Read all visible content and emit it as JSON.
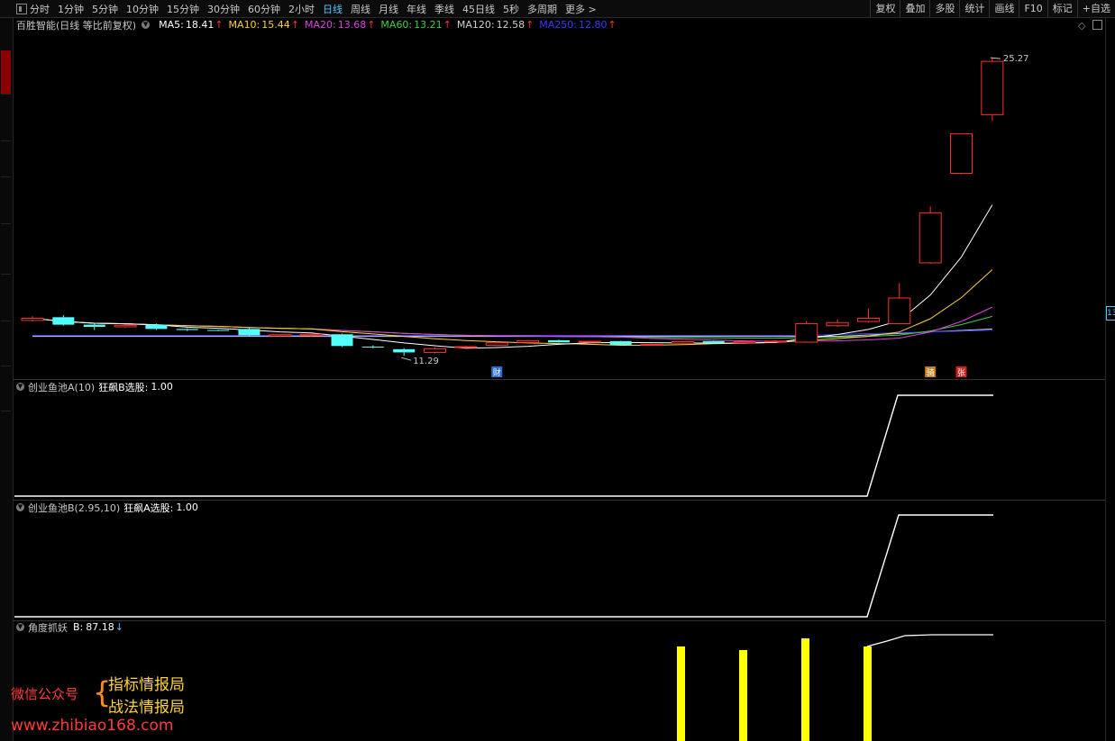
{
  "toolbar": {
    "periods": [
      "分时",
      "1分钟",
      "5分钟",
      "10分钟",
      "15分钟",
      "30分钟",
      "60分钟",
      "2小时",
      "日线",
      "周线",
      "月线",
      "年线",
      "季线",
      "45日线",
      "5秒",
      "多周期",
      "更多 >"
    ],
    "active_period": "日线",
    "tools": [
      "复权",
      "叠加",
      "多股",
      "统计",
      "画线",
      "F10",
      "标记",
      "+自选"
    ]
  },
  "main_pane": {
    "title": "百胜智能(日线 等比前复权)",
    "ma": [
      {
        "label": "MA5:",
        "value": "18.41",
        "color": "#ffffff"
      },
      {
        "label": "MA10:",
        "value": "15.44",
        "color": "#ffd23a"
      },
      {
        "label": "MA20:",
        "value": "13.68",
        "color": "#e040e0"
      },
      {
        "label": "MA60:",
        "value": "13.21",
        "color": "#40d040"
      },
      {
        "label": "MA120:",
        "value": "12.58",
        "color": "#d0d0d0"
      },
      {
        "label": "MA250:",
        "value": "12.80",
        "color": "#3a3aff"
      }
    ],
    "high_label": "25.27",
    "low_label": "11.29",
    "badges": [
      {
        "text": "财",
        "color": "#2a6fd0"
      },
      {
        "text": "骑",
        "color": "#c08020"
      },
      {
        "text": "张",
        "color": "#d02020"
      }
    ],
    "right_edge_price": "13"
  },
  "pane_a": {
    "title": "创业鱼池A(10)",
    "indicator": "狂飙B选股:",
    "value": "1.00"
  },
  "pane_b": {
    "title": "创业鱼池B(2.95,10)",
    "indicator": "狂飙A选股:",
    "value": "1.00"
  },
  "pane_c": {
    "title": "角度抓妖",
    "indicator": "B:",
    "value": "87.18"
  },
  "watermark": {
    "label": "微信公众号",
    "line1": "指标情报局",
    "line2": "战法情报局",
    "url": "www.zhibiao168.com"
  },
  "chart_data": {
    "type": "candlestick",
    "candles": [
      {
        "o": 12.95,
        "c": 13.05,
        "h": 13.15,
        "l": 12.9
      },
      {
        "o": 13.1,
        "c": 12.75,
        "h": 13.2,
        "l": 12.7
      },
      {
        "o": 12.75,
        "c": 12.65,
        "h": 12.8,
        "l": 12.5
      },
      {
        "o": 12.65,
        "c": 12.72,
        "h": 12.78,
        "l": 12.6
      },
      {
        "o": 12.75,
        "c": 12.55,
        "h": 12.8,
        "l": 12.5
      },
      {
        "o": 12.55,
        "c": 12.5,
        "h": 12.58,
        "l": 12.45
      },
      {
        "o": 12.5,
        "c": 12.48,
        "h": 12.52,
        "l": 12.45
      },
      {
        "o": 12.55,
        "c": 12.25,
        "h": 12.6,
        "l": 12.2
      },
      {
        "o": 12.22,
        "c": 12.28,
        "h": 12.3,
        "l": 12.2
      },
      {
        "o": 12.25,
        "c": 12.3,
        "h": 12.32,
        "l": 12.2
      },
      {
        "o": 12.3,
        "c": 11.75,
        "h": 12.33,
        "l": 11.7
      },
      {
        "o": 11.72,
        "c": 11.7,
        "h": 11.78,
        "l": 11.65
      },
      {
        "o": 11.6,
        "c": 11.45,
        "h": 11.65,
        "l": 11.29
      },
      {
        "o": 11.45,
        "c": 11.62,
        "h": 11.68,
        "l": 11.4
      },
      {
        "o": 11.7,
        "c": 11.72,
        "h": 11.76,
        "l": 11.68
      },
      {
        "o": 11.78,
        "c": 11.9,
        "h": 11.95,
        "l": 11.75
      },
      {
        "o": 11.92,
        "c": 12.0,
        "h": 12.03,
        "l": 11.9
      },
      {
        "o": 12.02,
        "c": 11.92,
        "h": 12.05,
        "l": 11.9
      },
      {
        "o": 11.93,
        "c": 11.97,
        "h": 12.0,
        "l": 11.9
      },
      {
        "o": 11.98,
        "c": 11.8,
        "h": 12.0,
        "l": 11.78
      },
      {
        "o": 11.8,
        "c": 11.83,
        "h": 11.86,
        "l": 11.78
      },
      {
        "o": 11.88,
        "c": 11.95,
        "h": 11.98,
        "l": 11.85
      },
      {
        "o": 11.98,
        "c": 11.88,
        "h": 12.0,
        "l": 11.86
      },
      {
        "o": 11.9,
        "c": 11.95,
        "h": 11.98,
        "l": 11.88
      },
      {
        "o": 11.95,
        "c": 11.98,
        "h": 12.02,
        "l": 11.93
      },
      {
        "o": 11.93,
        "c": 12.8,
        "h": 12.92,
        "l": 11.9
      },
      {
        "o": 12.7,
        "c": 12.85,
        "h": 13.0,
        "l": 12.65
      },
      {
        "o": 12.9,
        "c": 13.05,
        "h": 13.5,
        "l": 12.85
      },
      {
        "o": 12.8,
        "c": 14.0,
        "h": 14.7,
        "l": 12.8
      },
      {
        "o": 15.65,
        "c": 18.0,
        "h": 18.3,
        "l": 15.6
      },
      {
        "o": 19.85,
        "c": 21.7,
        "h": 21.7,
        "l": 19.8
      },
      {
        "o": 22.6,
        "c": 25.1,
        "h": 25.27,
        "l": 22.3
      }
    ],
    "ylim": [
      10.2,
      26.5
    ]
  }
}
